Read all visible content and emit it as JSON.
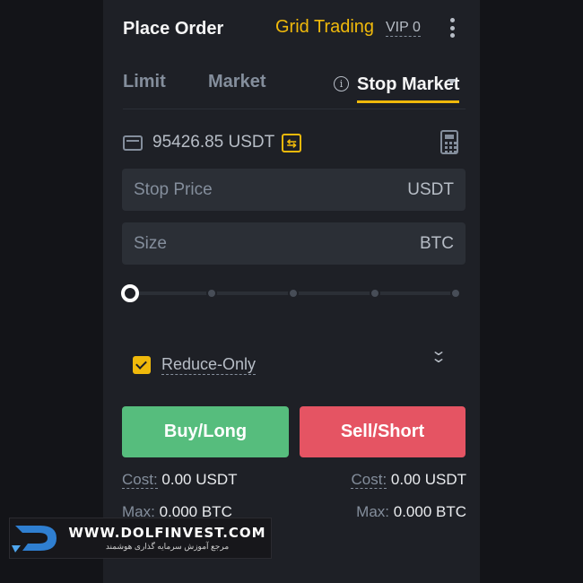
{
  "header": {
    "title": "Place Order",
    "grid_trading": "Grid Trading",
    "vip": "VIP 0",
    "more_icon": "vertical-dots-icon"
  },
  "tabs": [
    {
      "label": "Limit",
      "active": false
    },
    {
      "label": "Market",
      "active": false
    },
    {
      "label": "Stop Market",
      "active": true
    }
  ],
  "balance": {
    "value": "95426.85 USDT",
    "wallet_icon": "wallet-icon",
    "transfer_icon": "transfer-icon",
    "calculator_icon": "calculator-icon"
  },
  "fields": {
    "stop_price": {
      "label": "Stop Price",
      "unit": "USDT"
    },
    "size": {
      "label": "Size",
      "unit": "BTC"
    }
  },
  "slider": {
    "value_percent": 0,
    "steps": 5
  },
  "reduce_only": {
    "label": "Reduce-Only",
    "checked": true
  },
  "buttons": {
    "buy": "Buy/Long",
    "sell": "Sell/Short"
  },
  "summary": {
    "cost_label": "Cost:",
    "cost_left": "0.00 USDT",
    "cost_right": "0.00 USDT",
    "max_label": "Max:",
    "max_left": "0.000 BTC",
    "max_right": "0.000 BTC"
  },
  "watermark": {
    "url": "WWW.DOLFINVEST.COM",
    "subtitle": "مرجع آموزش سرمایه گذاری هوشمند"
  },
  "colors": {
    "accent": "#f0b90b",
    "buy": "#56bd7d",
    "sell": "#e55463",
    "panel": "#1e2026",
    "input": "#2b2f36"
  }
}
